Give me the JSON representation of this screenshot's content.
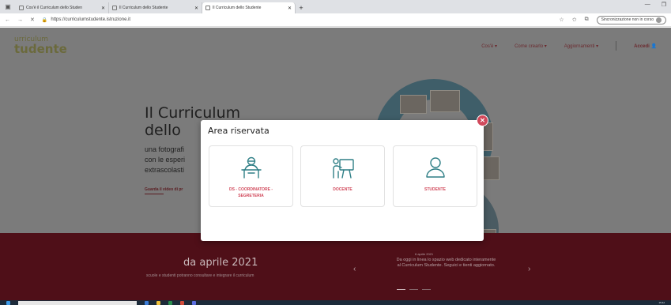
{
  "browser": {
    "tabs": [
      {
        "title": "Cos'è il Curriculum dello Studen",
        "active": false
      },
      {
        "title": "Il Curriculum dello Studente",
        "active": false
      },
      {
        "title": "Il Curriculum dello Studente",
        "active": true
      }
    ],
    "url": "https://curriculumstudente.istruzione.it",
    "sync_label": "Sincronizzazione non in corso"
  },
  "site": {
    "logo_top": "urriculum",
    "logo_bottom": "tudente",
    "nav": [
      "Cos'è",
      "Come crearlo",
      "Aggiornamenti"
    ],
    "login": "Accedi"
  },
  "hero": {
    "title_line1": "Il Curriculum",
    "title_line2": "dello",
    "sub_line1": "una fotografi",
    "sub_line2": "con le esperi",
    "sub_line3": "extrascolasti",
    "link": "Guarda il video di pr"
  },
  "modal": {
    "title": "Area riservata",
    "roles": [
      {
        "line1": "DS - COORDINATORE -",
        "line2": "SEGRETERIA",
        "icon": "teacher-desk-icon"
      },
      {
        "line1": "DOCENTE",
        "line2": "",
        "icon": "teacher-board-icon"
      },
      {
        "line1": "STUDENTE",
        "line2": "",
        "icon": "student-person-icon"
      }
    ]
  },
  "band": {
    "title": "da aprile 2021",
    "subtitle": "scuole e studenti potranno consultare e integrare il curriculum",
    "news_date": "6 aprile 2021",
    "news_line1": "Da oggi in linea lo spazio web dedicato interamente",
    "news_line2": "al Curriculum Studente. Seguici e tienti aggiornato."
  },
  "taskbar": {
    "clock": "15:42"
  },
  "colors": {
    "accent": "#d1495b",
    "band": "#4f0f18",
    "overlay": "#7b7b7b"
  }
}
